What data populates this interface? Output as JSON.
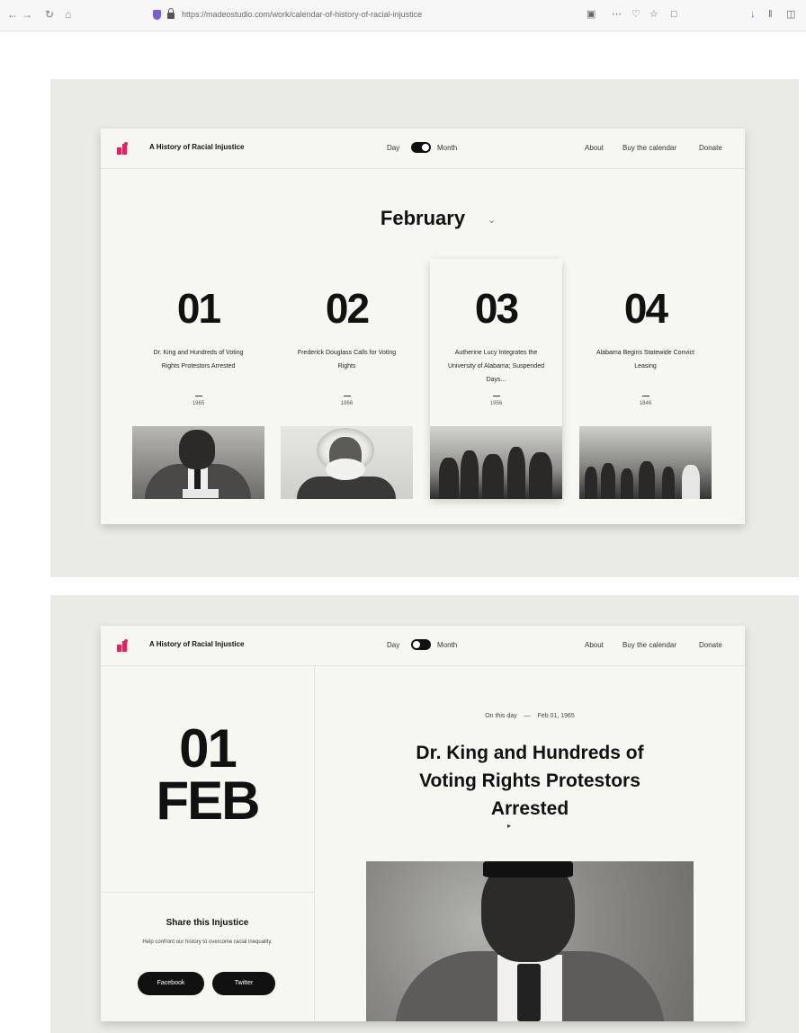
{
  "browser": {
    "url": "https://madeostudio.com/work/calendar-of-history-of-racial-injustice"
  },
  "site": {
    "title": "A History of Racial Injustice",
    "toggle_left": "Day",
    "toggle_right": "Month",
    "nav": [
      "About",
      "Buy the calendar",
      "Donate"
    ]
  },
  "month_view": {
    "month": "February",
    "cards": [
      {
        "day": "01",
        "title": "Dr. King and Hundreds of Voting Rights Protestors Arrested",
        "year": "1965"
      },
      {
        "day": "02",
        "title": "Frederick Douglass Calls for Voting Rights",
        "year": "1866"
      },
      {
        "day": "03",
        "title": "Autherine Lucy Integrates the University of Alabama; Suspended Days...",
        "year": "1956"
      },
      {
        "day": "04",
        "title": "Alabama Begins Statewide Convict Leasing",
        "year": "1846"
      }
    ]
  },
  "day_view": {
    "day": "01",
    "month_abbr": "FEB",
    "meta_label": "On this day",
    "meta_date": "Feb 01, 1965",
    "headline": "Dr. King and Hundreds of Voting Rights Protestors Arrested",
    "share_title": "Share this Injustice",
    "share_sub": "Help confront our history to overcome racial inequality.",
    "share_buttons": [
      "Facebook",
      "Twitter"
    ]
  }
}
